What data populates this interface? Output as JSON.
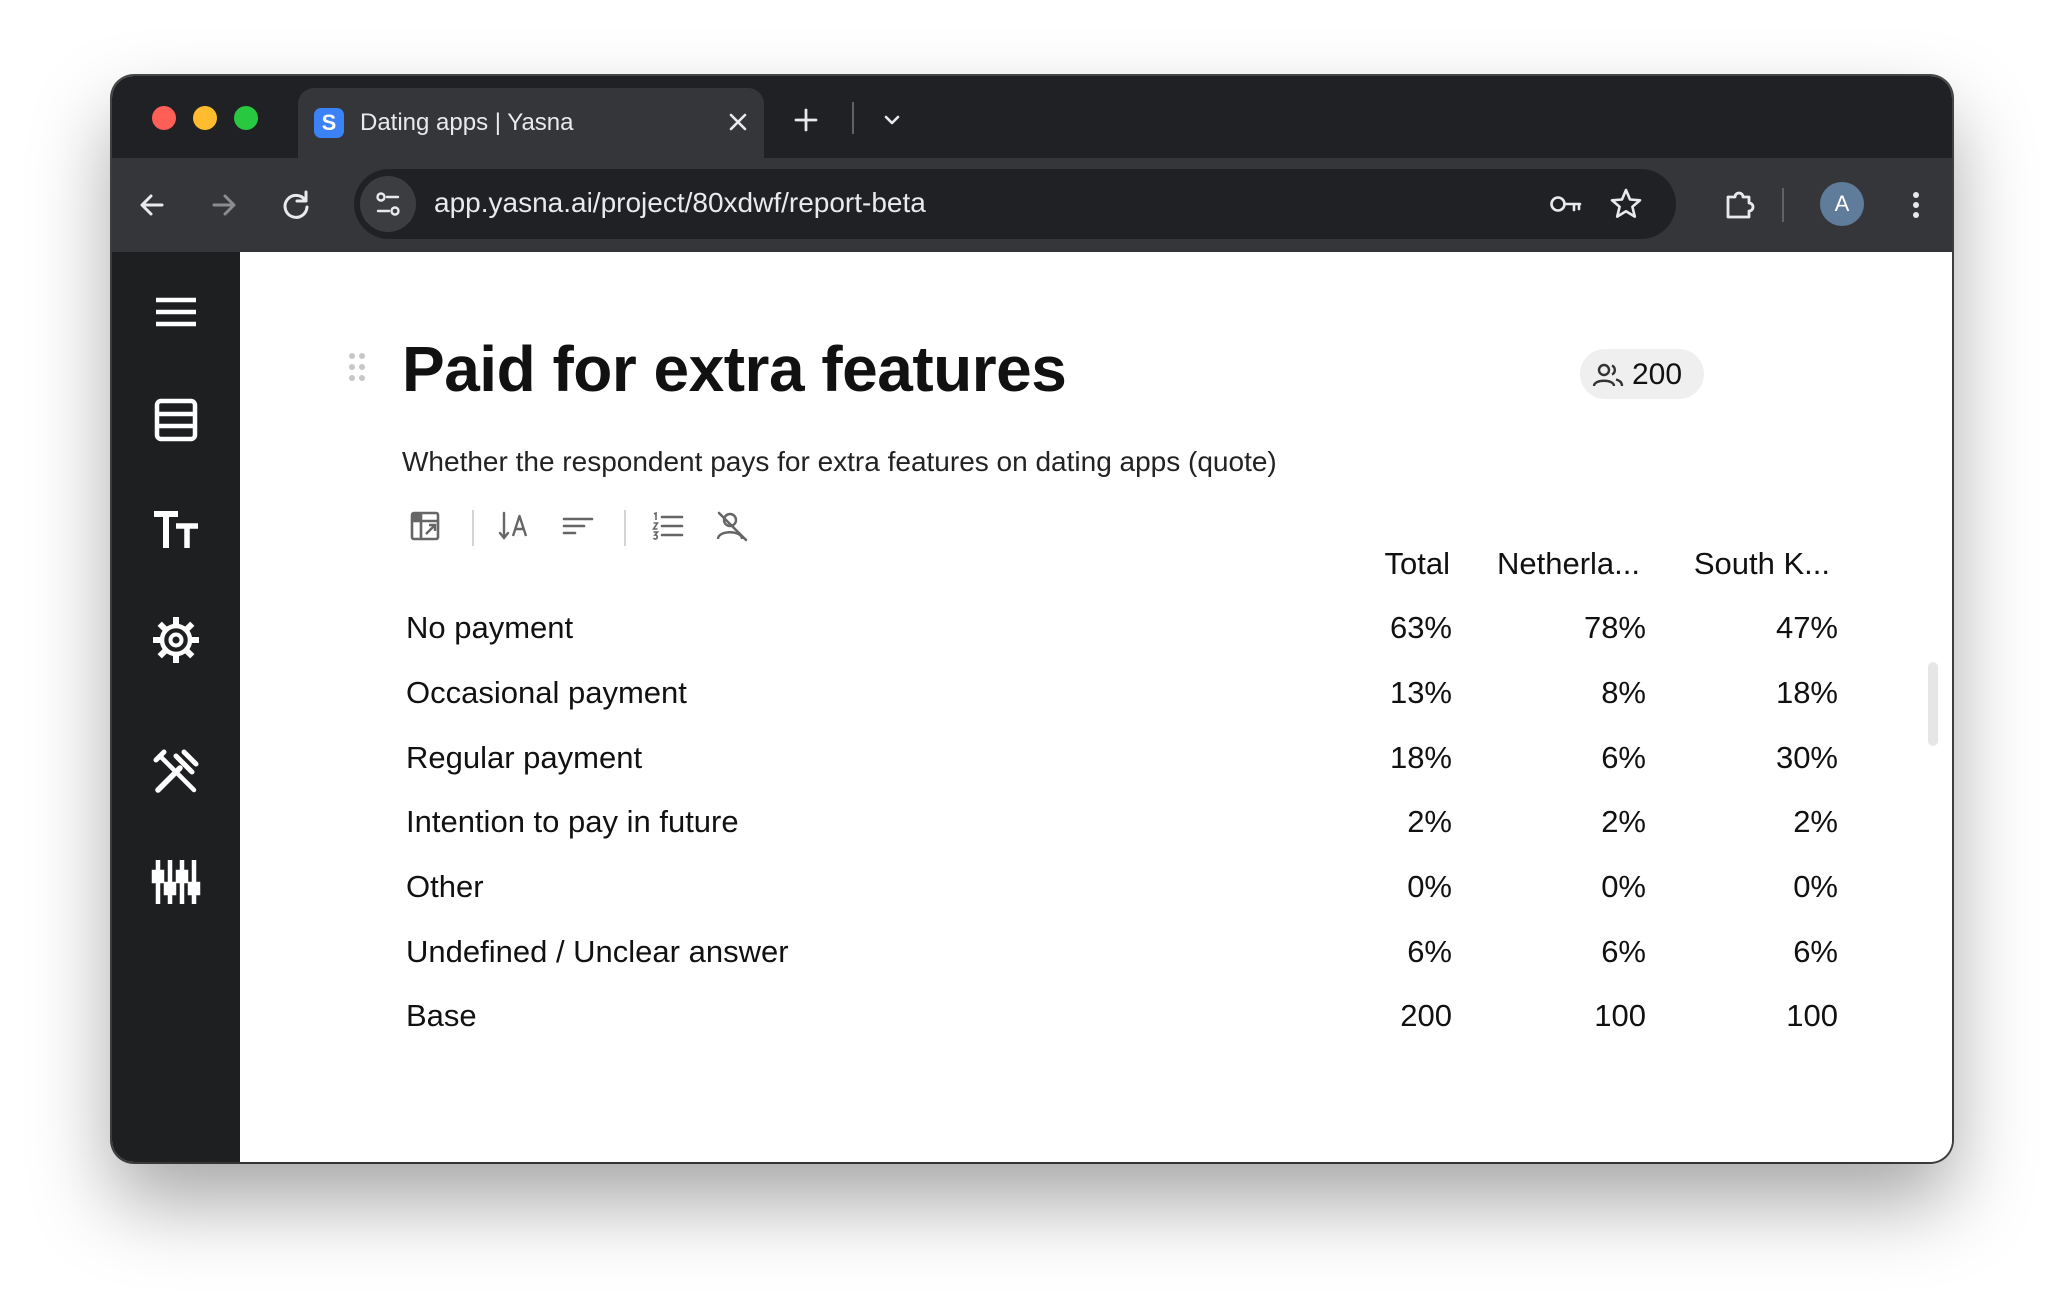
{
  "browser": {
    "tab_title": "Dating apps | Yasna",
    "tab_favicon_letter": "S",
    "url": "app.yasna.ai/project/80xdwf/report-beta",
    "profile_initial": "A",
    "icons": {
      "back": "arrow-left-icon",
      "forward": "arrow-right-icon",
      "reload": "reload-icon",
      "site_info": "tune-icon",
      "password": "key-icon",
      "bookmark": "star-icon",
      "extensions": "puzzle-icon",
      "menu": "more-vertical-icon"
    }
  },
  "sidebar": {
    "items": [
      "menu-icon",
      "table-icon",
      "text-size-icon",
      "settings-icon",
      "tools-icon",
      "sliders-icon"
    ]
  },
  "report": {
    "title": "Paid for extra features",
    "respondents": "200",
    "subtitle": "Whether the respondent pays for extra features on dating apps (quote)",
    "tools": [
      "pivot-icon",
      "sort-alpha-icon",
      "sort-icon",
      "numbered-list-icon",
      "hide-empty-icon"
    ]
  },
  "table": {
    "columns": [
      "Total",
      "Netherla...",
      "South K..."
    ],
    "rows": [
      {
        "label": "No payment",
        "values": [
          "63%",
          "78%",
          "47%"
        ]
      },
      {
        "label": "Occasional payment",
        "values": [
          "13%",
          "8%",
          "18%"
        ]
      },
      {
        "label": "Regular payment",
        "values": [
          "18%",
          "6%",
          "30%"
        ]
      },
      {
        "label": "Intention to pay in future",
        "values": [
          "2%",
          "2%",
          "2%"
        ]
      },
      {
        "label": "Other",
        "values": [
          "0%",
          "0%",
          "0%"
        ]
      },
      {
        "label": "Undefined / Unclear answer",
        "values": [
          "6%",
          "6%",
          "6%"
        ]
      },
      {
        "label": "Base",
        "values": [
          "200",
          "100",
          "100"
        ]
      }
    ]
  }
}
